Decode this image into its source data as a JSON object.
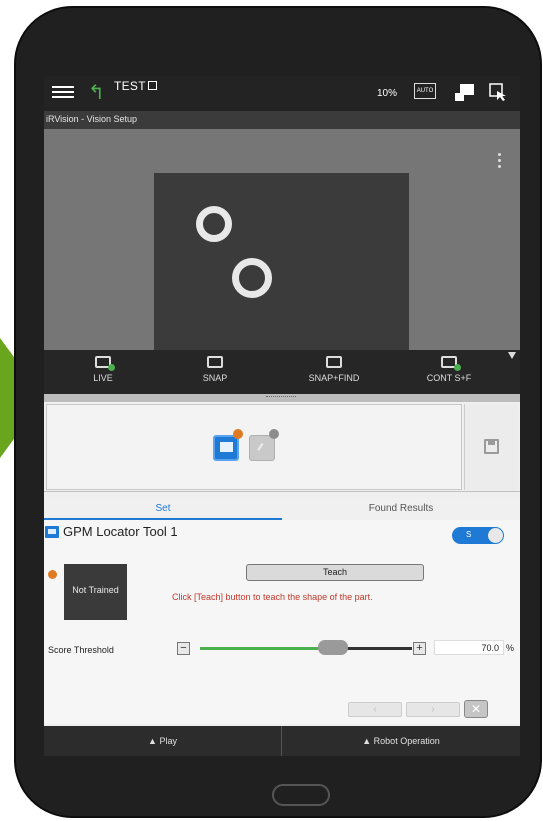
{
  "header": {
    "program_name": "TEST",
    "override": "10%",
    "auto_label": "AUTO"
  },
  "window_title": "iRVision - Vision Setup",
  "camera_toolbar": {
    "buttons": [
      {
        "label": "LIVE"
      },
      {
        "label": "SNAP"
      },
      {
        "label": "SNAP+FIND"
      },
      {
        "label": "CONT S+F"
      }
    ]
  },
  "tabs": [
    {
      "label": "Set",
      "active": true
    },
    {
      "label": "Found Results",
      "active": false
    }
  ],
  "tool": {
    "name": "GPM Locator Tool 1",
    "toggle_label": "S",
    "model_status": "Not Trained",
    "teach_label": "Teach",
    "teach_message": "Click [Teach] button to teach the shape of the part."
  },
  "score": {
    "label": "Score Threshold",
    "value": "70.0",
    "unit": "%",
    "slider_fraction": 0.7
  },
  "bottom_bar": {
    "play_label": "▲ Play",
    "robot_label": "▲ Robot Operation"
  },
  "colors": {
    "accent": "#1f7ad6",
    "slider_fill": "#4caf50",
    "warning": "#e07a22",
    "message": "#c0392b"
  }
}
